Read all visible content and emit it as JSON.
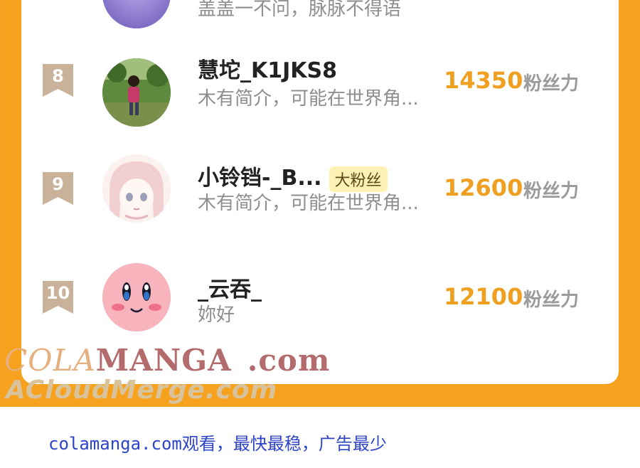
{
  "list": {
    "top_row_partial": {
      "desc": "盖盖一不问，脉脉不得语"
    },
    "rows": [
      {
        "rank": "8",
        "name": "慧坨_K1JKS8",
        "badge": "",
        "desc": "木有简介，可能在世界角...",
        "score": "14350",
        "score_unit": "粉丝力",
        "avatar": "photo-child-outdoors"
      },
      {
        "rank": "9",
        "name": "小铃铛-_B...",
        "badge": "大粉丝",
        "desc": "木有简介，可能在世界角...",
        "score": "12600",
        "score_unit": "粉丝力",
        "avatar": "anime-girl-pink-hair"
      },
      {
        "rank": "10",
        "name": "_云吞_",
        "badge": "",
        "desc": "妳好",
        "score": "12100",
        "score_unit": "粉丝力",
        "avatar": "kirby-face"
      }
    ]
  },
  "watermark": {
    "line1_a": "COLA",
    "line1_b": "MANGA",
    "line1_c": ".com",
    "line2": "ACloudMerge.com"
  },
  "footer": {
    "text": "colamanga.com观看，最快最稳，广告最少"
  },
  "colors": {
    "frame": "#f7a21e",
    "score": "#f0a020",
    "rank_badge": "#c9b19a",
    "footer_text": "#2d43c9"
  }
}
